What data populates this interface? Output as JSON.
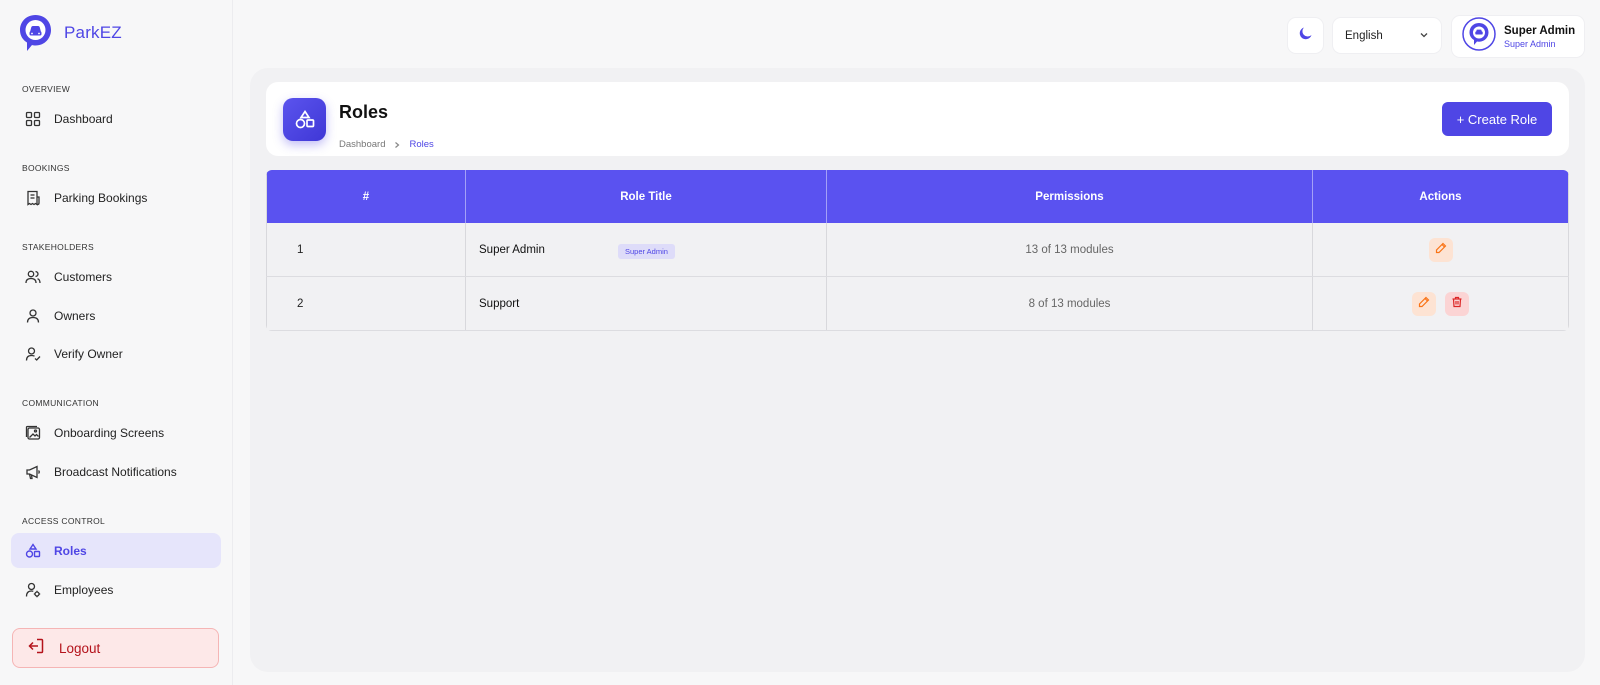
{
  "brand": {
    "name": "ParkEZ"
  },
  "sidebar": {
    "sections": [
      {
        "title": "OVERVIEW"
      },
      {
        "title": "BOOKINGS"
      },
      {
        "title": "STAKEHOLDERS"
      },
      {
        "title": "COMMUNICATION"
      },
      {
        "title": "ACCESS CONTROL"
      }
    ],
    "items": [
      {
        "label": "Dashboard",
        "icon": "grid-icon"
      },
      {
        "label": "Parking Bookings",
        "icon": "receipt-icon"
      },
      {
        "label": "Customers",
        "icon": "users-icon"
      },
      {
        "label": "Owners",
        "icon": "user-icon"
      },
      {
        "label": "Verify Owner",
        "icon": "user-check-icon"
      },
      {
        "label": "Onboarding Screens",
        "icon": "images-icon"
      },
      {
        "label": "Broadcast Notifications",
        "icon": "megaphone-icon"
      },
      {
        "label": "Roles",
        "icon": "shapes-icon",
        "active": true
      },
      {
        "label": "Employees",
        "icon": "user-cog-icon"
      }
    ],
    "logout_label": "Logout"
  },
  "topbar": {
    "language": "English",
    "user_name": "Super Admin",
    "user_role": "Super Admin"
  },
  "header": {
    "title": "Roles",
    "breadcrumb": [
      "Dashboard",
      "Roles"
    ],
    "create_label": "+ Create Role"
  },
  "table": {
    "columns": [
      "#",
      "Role Title",
      "Permissions",
      "Actions"
    ],
    "rows": [
      {
        "index": "1",
        "title": "Super Admin",
        "badge": "Super Admin",
        "permissions": "13 of 13 modules"
      },
      {
        "index": "2",
        "title": "Support",
        "badge": "",
        "permissions": "8 of 13 modules"
      }
    ]
  },
  "colors": {
    "accent": "#4f46e5",
    "header": "#5a52f0",
    "edit": "#f97316",
    "delete": "#dc2626"
  }
}
